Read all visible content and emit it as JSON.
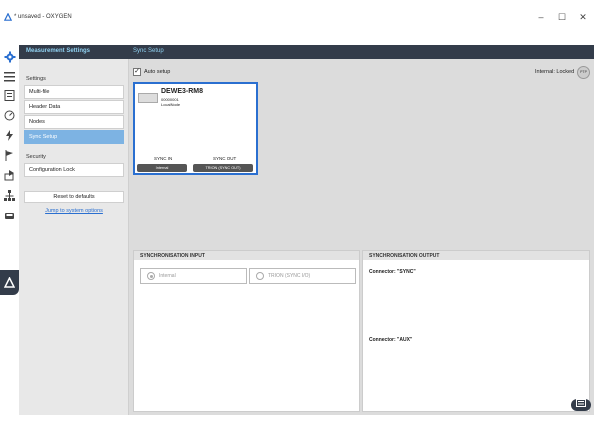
{
  "window": {
    "title": "* unsaved - OXYGEN",
    "minimize": "–",
    "maximize": "☐",
    "close": "✕"
  },
  "left_panel": {
    "header": "Measurement Settings",
    "settings_label": "Settings",
    "items": [
      {
        "label": "Multi-file"
      },
      {
        "label": "Header Data"
      },
      {
        "label": "Nodes"
      },
      {
        "label": "Sync Setup",
        "active": true
      }
    ],
    "security_label": "Security",
    "security_items": [
      {
        "label": "Configuration Lock"
      }
    ],
    "reset_button": "Reset to defaults",
    "jump_link": "Jump to system options"
  },
  "main": {
    "header": "Sync Setup",
    "auto_setup": {
      "label": "Auto setup",
      "checked": true,
      "mark": "✓"
    },
    "internal_locked": "Internal: Locked",
    "internal_locked_icon_text": "PTP",
    "device": {
      "name": "DEWE3-RM8",
      "serial": "00000001",
      "node": "LocalNode",
      "sync_in_label": "SYNC IN",
      "sync_out_label": "SYNC OUT",
      "sync_in_value": "Internal",
      "sync_out_value": "TRION (SYNC OUT)"
    },
    "sync_input": {
      "header": "SYNCHRONISATION INPUT",
      "options": [
        {
          "label": "Internal",
          "selected": true
        },
        {
          "label": "TRION (SYNC I/O)",
          "selected": false
        }
      ]
    },
    "sync_output": {
      "header": "SYNCHRONISATION OUTPUT",
      "connectors": [
        "Connector: \"SYNC\"",
        "Connector: \"AUX\""
      ]
    }
  },
  "icons": {
    "app": "oxygen-logo-icon",
    "sidebar": [
      "gear-icon",
      "list-icon",
      "report-icon",
      "gauge-icon",
      "lightning-icon",
      "flag-icon",
      "export-icon",
      "network-icon",
      "car-icon",
      "oxygen-icon"
    ],
    "corner": "expand-icon"
  },
  "colors": {
    "header_bg": "#333c4a",
    "header_text": "#8fd0f0",
    "active_item": "#7db3e3",
    "device_border": "#2a6fd0"
  }
}
